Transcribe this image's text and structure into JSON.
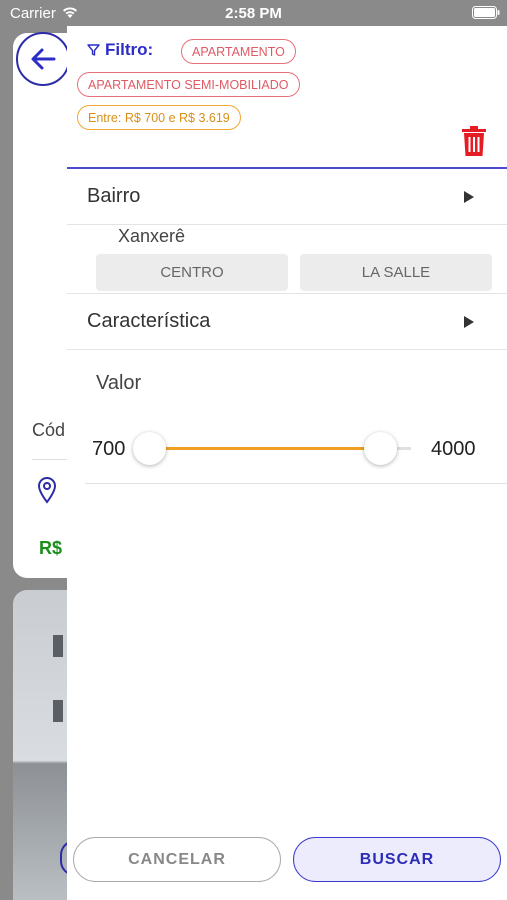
{
  "status_bar": {
    "carrier": "Carrier",
    "time": "2:58 PM"
  },
  "background": {
    "code_label": "Cód",
    "price_prefix": "R$"
  },
  "filter": {
    "title": "Filtro:",
    "chips": [
      {
        "label": "APARTAMENTO",
        "style": "red"
      },
      {
        "label": "APARTAMENTO SEMI-MOBILIADO",
        "style": "red"
      },
      {
        "label": "Entre: R$ 700 e R$ 3.619",
        "style": "orange"
      }
    ]
  },
  "bairro": {
    "label": "Bairro",
    "city": "Xanxerê",
    "neighborhoods": [
      "CENTRO",
      "LA SALLE"
    ]
  },
  "caracteristica": {
    "label": "Característica"
  },
  "valor": {
    "label": "Valor",
    "min_label": "700",
    "max_label": "4000",
    "range_min": 700,
    "range_max": 4000,
    "selected_low": 700,
    "selected_high": 3619
  },
  "footer": {
    "cancel_label": "CANCELAR",
    "search_label": "BUSCAR"
  },
  "colors": {
    "accent": "#2c2cc7",
    "chip_red": "#e05a64",
    "chip_orange": "#d89018",
    "slider": "#f0a020",
    "trash": "#e51c23",
    "price_green": "#1a8d1a"
  }
}
